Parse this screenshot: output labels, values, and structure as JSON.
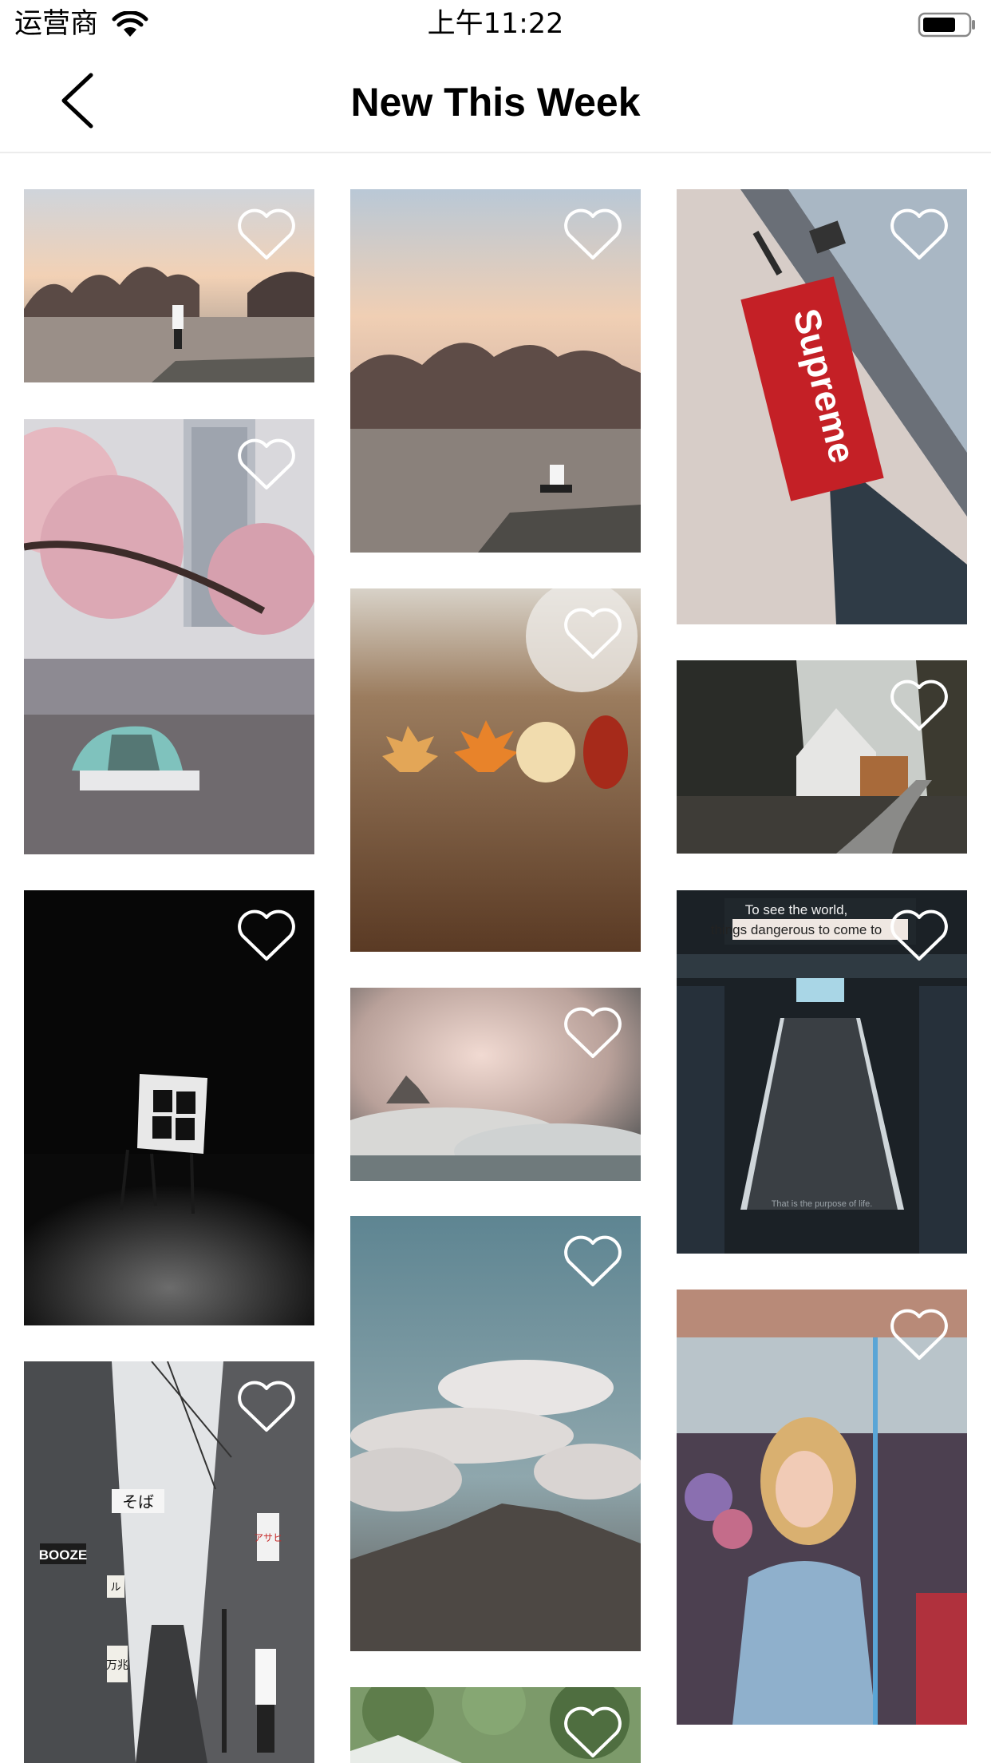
{
  "status_bar": {
    "carrier": "运营商",
    "time": "上午11:22"
  },
  "nav": {
    "title": "New This Week",
    "back_icon": "chevron-left-icon"
  },
  "photos": [
    {
      "id": "p1",
      "subject": "person-overlooking-bay",
      "favorite_icon": "heart-outline-icon"
    },
    {
      "id": "p2",
      "subject": "cherry-blossom-swan-boat",
      "favorite_icon": "heart-outline-icon"
    },
    {
      "id": "p3",
      "subject": "window-frame-on-easel",
      "favorite_icon": "heart-outline-icon"
    },
    {
      "id": "p4",
      "subject": "narrow-street-with-signs",
      "favorite_icon": "heart-outline-icon",
      "signs": [
        "そば",
        "BOOZE",
        "アサヒ",
        "万兆",
        "ル"
      ]
    },
    {
      "id": "p5",
      "subject": "person-sitting-over-bay",
      "favorite_icon": "heart-outline-icon"
    },
    {
      "id": "p6",
      "subject": "autumn-leaves",
      "favorite_icon": "heart-outline-icon"
    },
    {
      "id": "p7",
      "subject": "clouds-mountain-peak",
      "favorite_icon": "heart-outline-icon"
    },
    {
      "id": "p8",
      "subject": "clouds-over-mountains",
      "favorite_icon": "heart-outline-icon"
    },
    {
      "id": "p9",
      "subject": "green-trees",
      "favorite_icon": "heart-outline-icon"
    },
    {
      "id": "p10",
      "subject": "supreme-banner",
      "favorite_icon": "heart-outline-icon",
      "banner_text": "Supreme"
    },
    {
      "id": "p11",
      "subject": "cottage-road",
      "favorite_icon": "heart-outline-icon"
    },
    {
      "id": "p12",
      "subject": "stairs-with-quote",
      "favorite_icon": "heart-outline-icon",
      "sign_lines": [
        "To see the world,",
        "things dangerous to come to"
      ],
      "stair_text": "That is the purpose of life."
    },
    {
      "id": "p13",
      "subject": "woman-in-denim-jacket",
      "favorite_icon": "heart-outline-icon"
    }
  ]
}
